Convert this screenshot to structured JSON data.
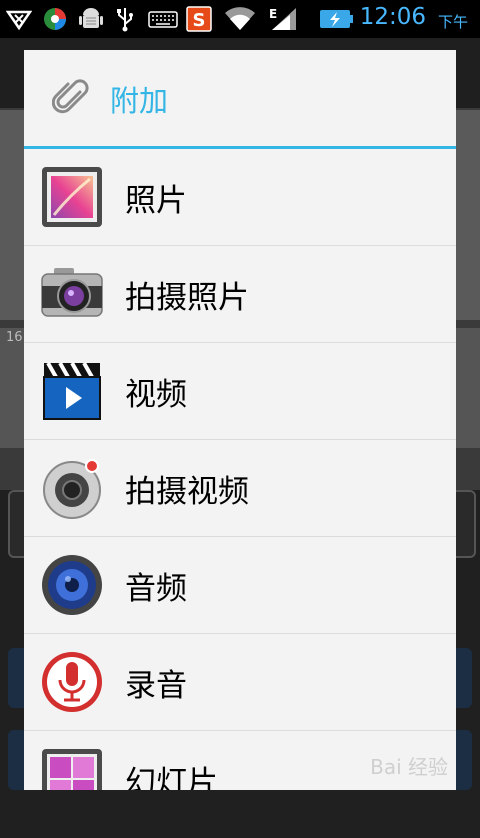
{
  "status_bar": {
    "time": "12:06",
    "ampm": "下午",
    "icons": [
      "wifi-off-icon",
      "browser-icon",
      "android-debug-icon",
      "usb-icon",
      "keyboard-icon",
      "sogou-input-icon",
      "wifi-icon",
      "edge-signal-icon",
      "battery-charging-icon"
    ],
    "network_label": "E"
  },
  "dialog": {
    "title": "附加",
    "items": [
      {
        "label": "照片",
        "icon": "gallery-icon"
      },
      {
        "label": "拍摄照片",
        "icon": "camera-icon"
      },
      {
        "label": "视频",
        "icon": "video-icon"
      },
      {
        "label": "拍摄视频",
        "icon": "camcorder-icon"
      },
      {
        "label": "音频",
        "icon": "audio-icon"
      },
      {
        "label": "录音",
        "icon": "microphone-icon"
      },
      {
        "label": "幻灯片",
        "icon": "slideshow-icon"
      }
    ]
  },
  "background": {
    "number_hint": "16"
  },
  "watermark": "Bai 经验",
  "colors": {
    "accent": "#33b5e5",
    "clock": "#49b8ff"
  }
}
